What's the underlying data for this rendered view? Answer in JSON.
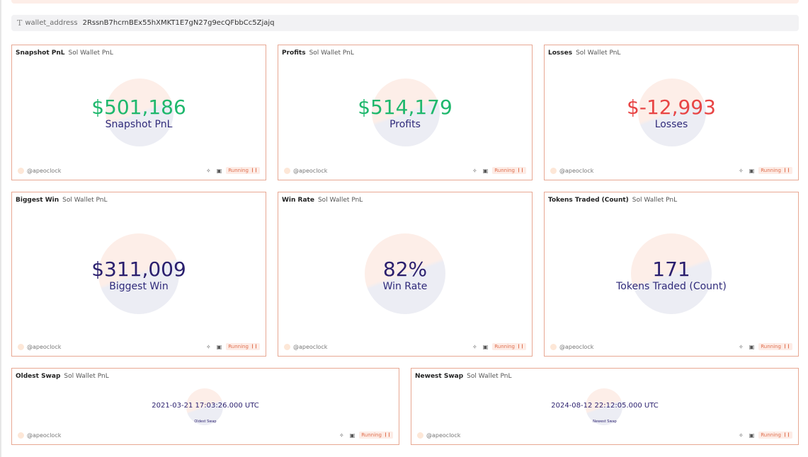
{
  "parameter": {
    "icon": "text-type-icon",
    "name": "wallet_address",
    "value": "2RssnB7hcrnBEx55hXMKT1E7gN27g9ecQFbbCc5Zjajq"
  },
  "colors": {
    "positive": "#1fb86d",
    "negative": "#e84545",
    "neutral": "#2a1f6e",
    "border": "#e8a893",
    "running_badge_bg": "#fdece6",
    "running_badge_text": "#e07050"
  },
  "footer": {
    "author": "@apeoclock",
    "status": "Running",
    "icons": [
      "sparkle-icon",
      "camera-icon",
      "pause-icon"
    ]
  },
  "cards": [
    {
      "title": "Snapshot PnL",
      "source": "Sol Wallet PnL",
      "value": "$501,186",
      "label": "Snapshot PnL"
    },
    {
      "title": "Profits",
      "source": "Sol Wallet PnL",
      "value": "$514,179",
      "label": "Profits"
    },
    {
      "title": "Losses",
      "source": "Sol Wallet PnL",
      "value": "$-12,993",
      "label": "Losses"
    },
    {
      "title": "Biggest Win",
      "source": "Sol Wallet PnL",
      "value": "$311,009",
      "label": "Biggest Win"
    },
    {
      "title": "Win Rate",
      "source": "Sol Wallet PnL",
      "value": "82%",
      "label": "Win Rate"
    },
    {
      "title": "Tokens Traded (Count)",
      "source": "Sol Wallet PnL",
      "value": "171",
      "label": "Tokens Traded (Count)"
    },
    {
      "title": "Oldest Swap",
      "source": "Sol Wallet PnL",
      "value": "2021-03-21 17:03:26.000 UTC",
      "label": "Oldest Swap"
    },
    {
      "title": "Newest Swap",
      "source": "Sol Wallet PnL",
      "value": "2024-08-12 22:12:05.000 UTC",
      "label": "Newest Swap"
    }
  ]
}
